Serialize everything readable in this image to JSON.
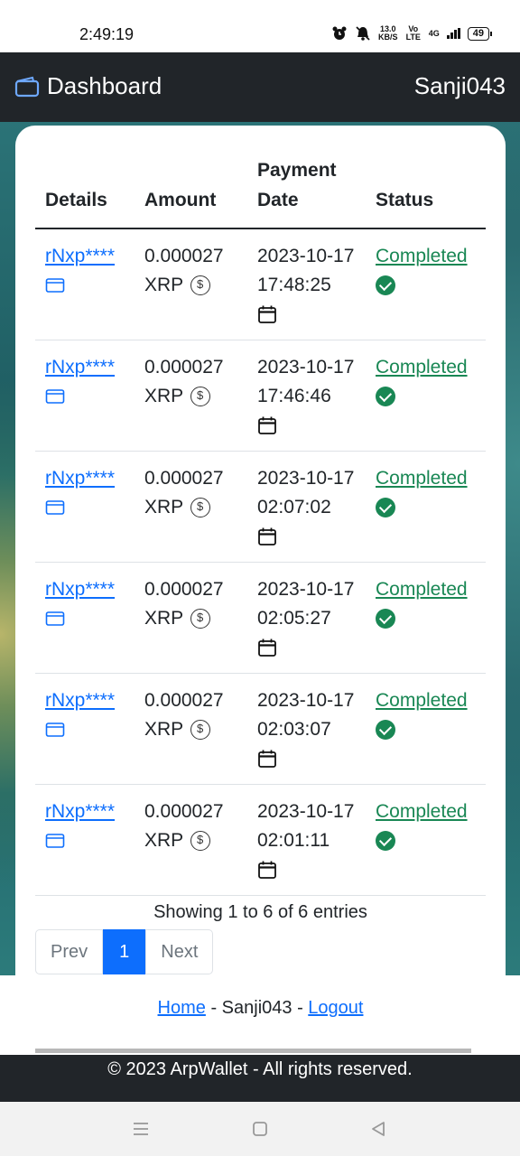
{
  "status_bar": {
    "time": "2:49:19",
    "net_speed": "13.0 KB/S",
    "net_label": "Vo LTE",
    "network": "4G",
    "battery": "49"
  },
  "navbar": {
    "brand": "Dashboard",
    "user": "Sanji043"
  },
  "table": {
    "headers": [
      "Details",
      "Amount",
      "Payment Date",
      "Status"
    ],
    "rows": [
      {
        "details": "rNxp****",
        "amount": "0.000027",
        "currency": "XRP",
        "date": "2023-10-17",
        "time": "17:48:25",
        "status": "Completed"
      },
      {
        "details": "rNxp****",
        "amount": "0.000027",
        "currency": "XRP",
        "date": "2023-10-17",
        "time": "17:46:46",
        "status": "Completed"
      },
      {
        "details": "rNxp****",
        "amount": "0.000027",
        "currency": "XRP",
        "date": "2023-10-17",
        "time": "02:07:02",
        "status": "Completed"
      },
      {
        "details": "rNxp****",
        "amount": "0.000027",
        "currency": "XRP",
        "date": "2023-10-17",
        "time": "02:05:27",
        "status": "Completed"
      },
      {
        "details": "rNxp****",
        "amount": "0.000027",
        "currency": "XRP",
        "date": "2023-10-17",
        "time": "02:03:07",
        "status": "Completed"
      },
      {
        "details": "rNxp****",
        "amount": "0.000027",
        "currency": "XRP",
        "date": "2023-10-17",
        "time": "02:01:11",
        "status": "Completed"
      }
    ]
  },
  "entries_info": "Showing 1 to 6 of 6 entries",
  "pagination": {
    "prev": "Prev",
    "current": "1",
    "next": "Next"
  },
  "footer_links": {
    "home": "Home",
    "sep1": " - ",
    "user": "Sanji043",
    "sep2": " - ",
    "logout": "Logout"
  },
  "footer": {
    "copyright": "© 2023 ArpWallet - All rights reserved."
  },
  "colors": {
    "navbar_bg": "#212529",
    "link": "#0d6efd",
    "success": "#198754"
  },
  "icons": {
    "brand": "wallet-icon",
    "details": "wallet-icon",
    "amount": "dollar-coin-icon",
    "date": "calendar-icon",
    "status": "check-circle-icon"
  }
}
